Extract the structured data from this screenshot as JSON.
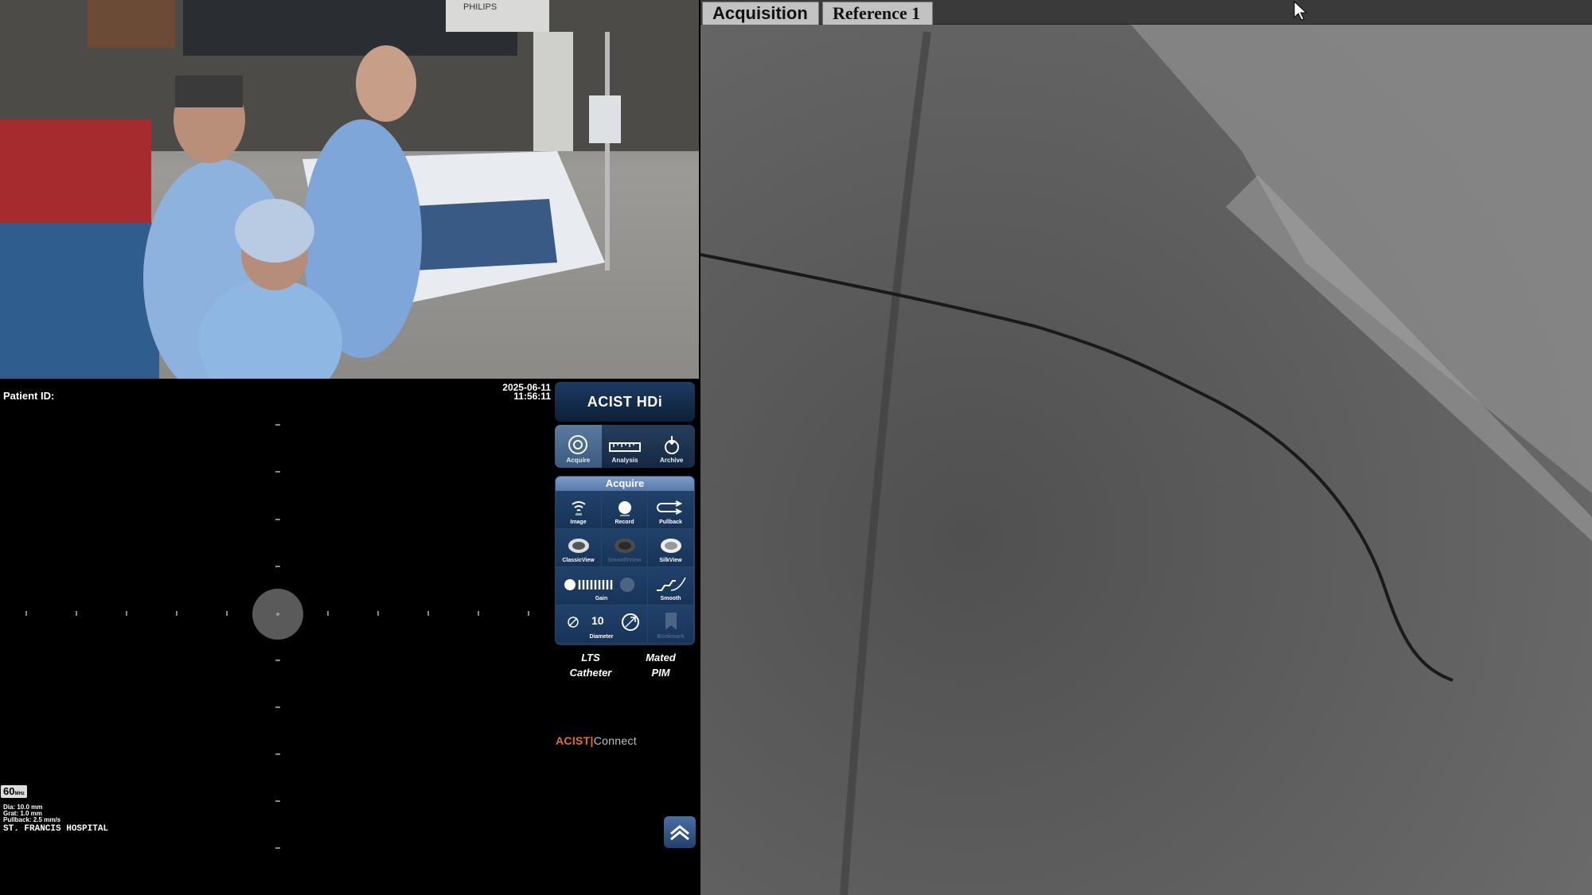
{
  "camera": {
    "monitor_brand": "PHILIPS"
  },
  "ivus": {
    "patient_label": "Patient ID:",
    "date": "2025-06-11",
    "time": "11:56:11",
    "frequency": "60",
    "frequency_unit": "MHz",
    "dia": "Dia: 10.0 mm",
    "grat": "Grat: 1.0 mm",
    "pullback": "Pullback: 2.5 mm/s",
    "hospital": "ST. FRANCIS HOSPITAL"
  },
  "acist": {
    "logo": "ACIST HDi",
    "modes": [
      {
        "label": "Acquire",
        "icon": "acquire-icon",
        "active": true
      },
      {
        "label": "Analysis",
        "icon": "ruler-icon",
        "active": false
      },
      {
        "label": "Archive",
        "icon": "archive-icon",
        "active": false
      }
    ],
    "panel_title": "Acquire",
    "controls": [
      {
        "label": "Image",
        "icon": "image-icon"
      },
      {
        "label": "Record",
        "icon": "record-icon"
      },
      {
        "label": "Pullback",
        "icon": "pullback-icon"
      },
      {
        "label": "ClassicView",
        "icon": "classicview-icon"
      },
      {
        "label": "SmoothView",
        "icon": "smoothview-icon"
      },
      {
        "label": "SilkView",
        "icon": "silkview-icon"
      },
      {
        "label": "Gain",
        "icon": "gain-icon"
      },
      {
        "label": "",
        "icon": "gain-knob-icon"
      },
      {
        "label": "Smooth",
        "icon": "smooth-icon"
      },
      {
        "label": "Diameter",
        "icon": "diameter-icon",
        "value": "10"
      },
      {
        "label": "",
        "icon": "diameter-expand-icon"
      },
      {
        "label": "Bookmark",
        "icon": "bookmark-icon"
      }
    ],
    "device_left": {
      "line1": "LTS",
      "line2": "Catheter"
    },
    "device_right": {
      "line1": "Mated",
      "line2": "PIM"
    },
    "connect_brand": "ACIST",
    "connect_product": "Connect"
  },
  "angio": {
    "tabs": [
      "Acquisition",
      "Reference 1"
    ]
  },
  "colors": {
    "acist_blue": "#1d3b63",
    "connect_orange": "#e07030"
  }
}
